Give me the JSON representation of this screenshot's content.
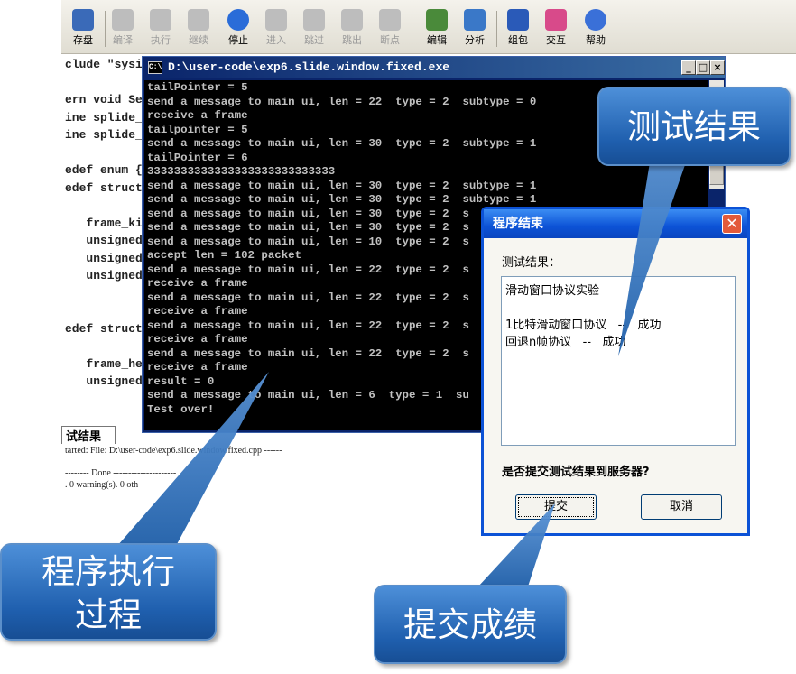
{
  "toolbar": {
    "items": [
      {
        "label": "存盘",
        "icon": "floppy-icon",
        "enabled": true
      },
      {
        "label": "编译",
        "icon": "compile-icon",
        "enabled": false
      },
      {
        "label": "执行",
        "icon": "run-icon",
        "enabled": false
      },
      {
        "label": "继续",
        "icon": "continue-icon",
        "enabled": false
      },
      {
        "label": "停止",
        "icon": "stop-icon",
        "enabled": true
      },
      {
        "label": "进入",
        "icon": "step-into-icon",
        "enabled": false
      },
      {
        "label": "跳过",
        "icon": "step-over-icon",
        "enabled": false
      },
      {
        "label": "跳出",
        "icon": "step-out-icon",
        "enabled": false
      },
      {
        "label": "断点",
        "icon": "breakpoint-icon",
        "enabled": false
      },
      {
        "label": "编辑",
        "icon": "edit-icon",
        "enabled": true
      },
      {
        "label": "分析",
        "icon": "chart-icon",
        "enabled": true
      },
      {
        "label": "组包",
        "icon": "package-icon",
        "enabled": true
      },
      {
        "label": "交互",
        "icon": "interact-icon",
        "enabled": true
      },
      {
        "label": "帮助",
        "icon": "help-icon",
        "enabled": true
      }
    ]
  },
  "editor": {
    "lines": [
      "clude \"sysir",
      "",
      "ern void Ser",
      "ine splide_",
      "ine splide_",
      "",
      "edef enum {c",
      "edef struct",
      "",
      "   frame_kir",
      "   unsigned",
      "   unsigned",
      "   unsigned",
      "",
      "",
      "edef struct",
      "",
      "   frame_hea",
      "   unsigned"
    ]
  },
  "output": {
    "tab_label": "试结果",
    "lines": [
      "tarted: File: D:\\user-code\\exp6.slide.window.fixed.cpp ------",
      "",
      "-------- Done ---------------------",
      ". 0 warning(s). 0 oth"
    ]
  },
  "console": {
    "title": "D:\\user-code\\exp6.slide.window.fixed.exe",
    "icon_text": "C:\\",
    "lines": [
      "tailPointer = 5",
      "send a message to main ui, len = 22  type = 2  subtype = 0",
      "receive a frame",
      "tailpointer = 5",
      "send a message to main ui, len = 30  type = 2  subtype = 1",
      "tailPointer = 6",
      "3333333333333333333333333333",
      "send a message to main ui, len = 30  type = 2  subtype = 1",
      "send a message to main ui, len = 30  type = 2  subtype = 1",
      "send a message to main ui, len = 30  type = 2  s",
      "send a message to main ui, len = 30  type = 2  s",
      "send a message to main ui, len = 10  type = 2  s",
      "accept len = 102 packet",
      "send a message to main ui, len = 22  type = 2  s",
      "receive a frame",
      "send a message to main ui, len = 22  type = 2  s",
      "receive a frame",
      "send a message to main ui, len = 22  type = 2  s",
      "receive a frame",
      "send a message to main ui, len = 22  type = 2  s",
      "receive a frame",
      "result = 0",
      "send a message to main ui, len = 6  type = 1  su",
      "Test over!"
    ]
  },
  "dialog": {
    "title": "程序结束",
    "label": "测试结果：",
    "result_lines": [
      "滑动窗口协议实验",
      "",
      "1比特滑动窗口协议   --   成功",
      "回退n帧协议   --   成功"
    ],
    "question": "是否提交测试结果到服务器?",
    "submit_label": "提交",
    "cancel_label": "取消"
  },
  "callouts": {
    "test_result": "测试结果",
    "execution": [
      "程序执行",
      "过程"
    ],
    "submit": "提交成绩"
  },
  "colors": {
    "console_bg": "#000000",
    "console_text": "#c0c0c0",
    "xp_title_blue": "#0c52d6",
    "callout_blue": "#2a6cbf"
  }
}
